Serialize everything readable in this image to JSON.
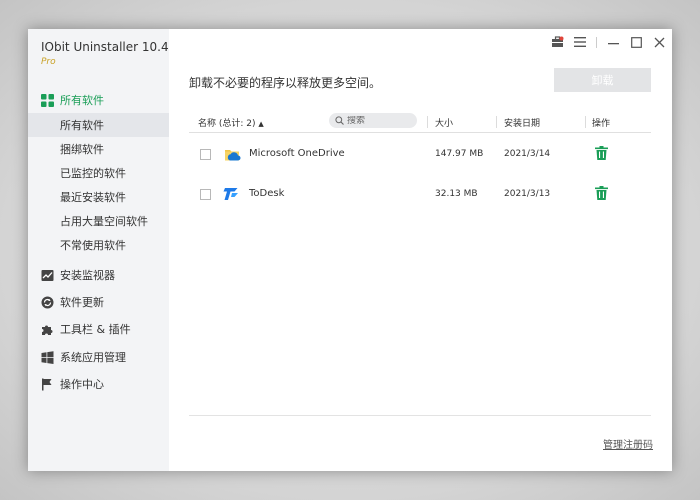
{
  "app": {
    "title": "IObit Uninstaller 10.4",
    "edition": "Pro",
    "accent_color": "#1a9e57",
    "edition_color": "#c9a227"
  },
  "titlebar": {
    "icons": [
      "toolbox-icon",
      "menu-icon",
      "minimize-icon",
      "maximize-icon",
      "close-icon"
    ]
  },
  "sidebar": {
    "main_items": [
      {
        "label": "所有软件",
        "icon": "grid-icon",
        "active": true
      },
      {
        "label": "安装监视器",
        "icon": "monitor-chart-icon"
      },
      {
        "label": "软件更新",
        "icon": "update-icon"
      },
      {
        "label": "工具栏 & 插件",
        "icon": "puzzle-icon"
      },
      {
        "label": "系统应用管理",
        "icon": "windows-logo-icon"
      },
      {
        "label": "操作中心",
        "icon": "flag-icon"
      }
    ],
    "sub_items": [
      {
        "label": "所有软件",
        "selected": true
      },
      {
        "label": "捆绑软件"
      },
      {
        "label": "已监控的软件"
      },
      {
        "label": "最近安装软件"
      },
      {
        "label": "占用大量空间软件"
      },
      {
        "label": "不常使用软件"
      }
    ]
  },
  "main": {
    "headline": "卸载不必要的程序以释放更多空间。",
    "uninstall_label": "卸载",
    "columns": {
      "name": "名称 (总计: 2)",
      "search_placeholder": "搜索",
      "size": "大小",
      "date": "安装日期",
      "action": "操作"
    },
    "rows": [
      {
        "name": "Microsoft OneDrive",
        "size": "147.97 MB",
        "date": "2021/3/14",
        "icon": "onedrive-icon"
      },
      {
        "name": "ToDesk",
        "size": "32.13 MB",
        "date": "2021/3/13",
        "icon": "todesk-icon"
      }
    ],
    "manage_link": "管理注册码"
  }
}
